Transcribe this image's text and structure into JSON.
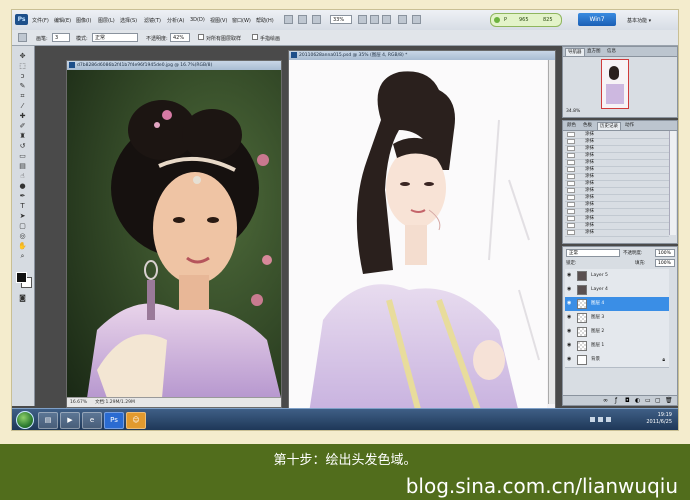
{
  "menubar": {
    "logo": "Ps",
    "items": [
      "文件(F)",
      "编辑(E)",
      "图像(I)",
      "图层(L)",
      "选择(S)",
      "滤镜(T)",
      "分析(A)",
      "3D(D)",
      "视图(V)",
      "窗口(W)",
      "帮助(H)"
    ],
    "zoom": "33%",
    "bridge": {
      "label": "P",
      "value1": "965",
      "value2": "825"
    },
    "version_button": "Win7",
    "workspace": "基本功能 ▾"
  },
  "options": {
    "brush_label": "画笔:",
    "brush_size": "3",
    "mode_label": "模式:",
    "mode_value": "正常",
    "opacity_label": "不透明度:",
    "opacity_value": "42%",
    "check1_label": "对所有图层取样",
    "check2_label": "手指绘画"
  },
  "doc_left": {
    "title": "d7b8286d6086b2f41b7f4e96f1945de0.jpg @ 16.7%(RGB/8)",
    "zoom": "16.67%",
    "doc_info": "文档:1.29M/1.29M"
  },
  "doc_right": {
    "title": "20110628anna015.psd @ 35% (图层 4, RGB/8) *"
  },
  "navigator": {
    "tabs": [
      "导航器",
      "直方图",
      "信息"
    ],
    "zoom": "34.8%"
  },
  "history": {
    "tabs": [
      "颜色",
      "色板",
      "历史记录",
      "动作"
    ],
    "items": [
      "涂抹",
      "涂抹",
      "涂抹",
      "涂抹",
      "涂抹",
      "涂抹",
      "涂抹",
      "涂抹",
      "涂抹",
      "涂抹",
      "涂抹",
      "涂抹",
      "涂抹",
      "涂抹",
      "涂抹"
    ]
  },
  "layers": {
    "blend_mode": "正常",
    "opacity_label": "不透明度:",
    "opacity": "100%",
    "lock_label": "锁定:",
    "fill_label": "填充:",
    "fill": "100%",
    "items": [
      {
        "name": "Layer 5",
        "selected": false
      },
      {
        "name": "Layer 4",
        "selected": false
      },
      {
        "name": "图层 4",
        "selected": true
      },
      {
        "name": "图层 3",
        "selected": false
      },
      {
        "name": "图层 2",
        "selected": false
      },
      {
        "name": "图层 1",
        "selected": false
      },
      {
        "name": "背景",
        "selected": false
      }
    ]
  },
  "taskbar": {
    "time": "19:19",
    "date": "2011/6/25"
  },
  "banner": {
    "caption": "第十步：绘出头发色域。",
    "watermark": "blog.sina.com.cn/lianwuqiu"
  }
}
